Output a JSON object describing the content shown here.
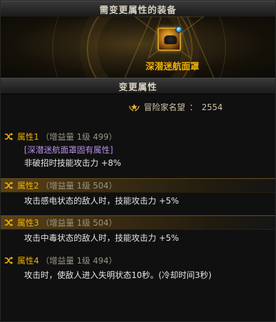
{
  "header": {
    "equip_title": "需变更属性的装备",
    "change_title": "变更属性"
  },
  "item": {
    "name": "深潜迷航面罩",
    "icon": "diving-mask-icon",
    "gem_icon": "blue-gem-icon"
  },
  "fame": {
    "icon": "fame-laurel-icon",
    "label": "冒险家名望",
    "separator": "：",
    "value": "2554"
  },
  "properties": [
    {
      "title": "属性1",
      "meta_open": "（",
      "meta_label": "增益量 1级",
      "meta_value": "499",
      "meta_close": "）",
      "tag": "[深潜迷航面罩固有属性]",
      "desc": "非破招时技能攻击力 +8%",
      "highlighted": false
    },
    {
      "title": "属性2",
      "meta_open": "（",
      "meta_label": "增益量 1级",
      "meta_value": "504",
      "meta_close": "）",
      "desc": "攻击感电状态的敌人时，技能攻击力 +5%",
      "highlighted": true
    },
    {
      "title": "属性3",
      "meta_open": "（",
      "meta_label": "增益量 1级",
      "meta_value": "504",
      "meta_close": "）",
      "desc": "攻击中毒状态的敌人时，技能攻击力 +5%",
      "highlighted": true
    },
    {
      "title": "属性4",
      "meta_open": "（",
      "meta_label": "增益量 1级",
      "meta_value": "494",
      "meta_close": "）",
      "desc": "攻击时，使敌人进入失明状态10秒。(冷却时间3秒)",
      "highlighted": false
    }
  ],
  "colors": {
    "accent": "#f0b000",
    "tag": "#b590e8",
    "meta": "#9a9486"
  }
}
